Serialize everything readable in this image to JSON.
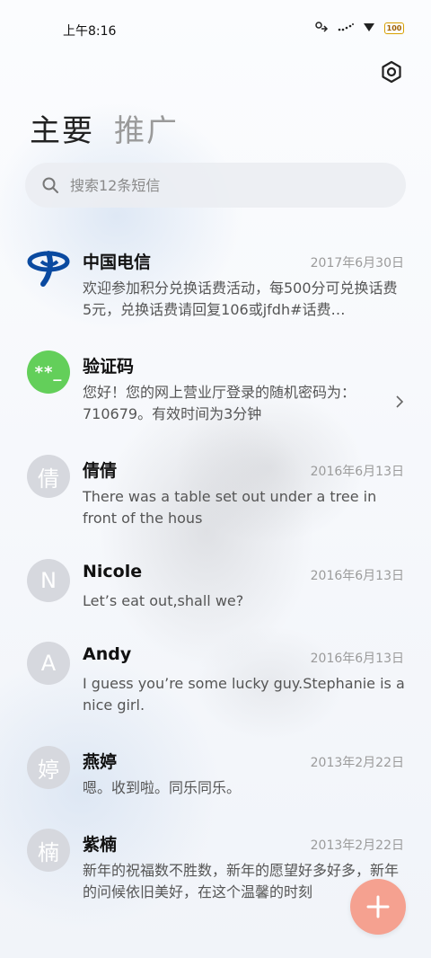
{
  "status_bar": {
    "time": "上午8:16",
    "battery": "100"
  },
  "tabs": {
    "main": "主要",
    "promo": "推广"
  },
  "search": {
    "placeholder": "搜索12条短信"
  },
  "conversations": [
    {
      "avatar_text": "",
      "avatar_kind": "telecom-logo",
      "name": "中国电信",
      "date": "2017年6月30日",
      "preview": "欢迎参加积分兑换话费活动，每500分可兑换话费5元，兑换话费请回复106或jfdh#话费…"
    },
    {
      "avatar_text": "**_",
      "avatar_kind": "verification",
      "name": "验证码",
      "date": "",
      "preview": "您好！您的网上营业厅登录的随机密码为：710679。有效时间为3分钟"
    },
    {
      "avatar_text": "倩",
      "avatar_kind": "initial",
      "name": "倩倩",
      "date": "2016年6月13日",
      "preview": "There was a table set out under a tree in front of the hous"
    },
    {
      "avatar_text": "N",
      "avatar_kind": "initial",
      "name": "Nicole",
      "date": "2016年6月13日",
      "preview": "Let’s eat out,shall we?"
    },
    {
      "avatar_text": "A",
      "avatar_kind": "initial",
      "name": "Andy",
      "date": "2016年6月13日",
      "preview": "I guess you’re some lucky guy.Stephanie is a nice girl."
    },
    {
      "avatar_text": "婷",
      "avatar_kind": "initial",
      "name": "燕婷",
      "date": "2013年2月22日",
      "preview": "嗯。收到啦。同乐同乐。"
    },
    {
      "avatar_text": "楠",
      "avatar_kind": "initial",
      "name": "紫楠",
      "date": "2013年2月22日",
      "preview": "新年的祝福数不胜数，新年的愿望好多好多，新年的问候依旧美好，在这个温馨的时刻"
    }
  ],
  "colors": {
    "verification_avatar": "#63cf5a",
    "fab": "#f5a190",
    "telecom_blue": "#0a4aa0"
  },
  "icons": {
    "settings": "gear-icon",
    "search": "search-icon",
    "fab": "plus-icon",
    "chevron": "chevron-right-icon"
  }
}
